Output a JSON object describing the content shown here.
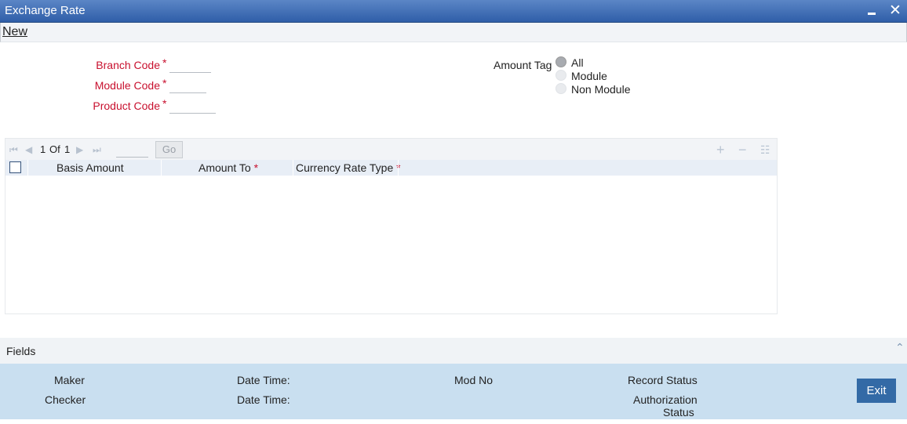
{
  "window": {
    "title": "Exchange Rate"
  },
  "menu": {
    "new_label": "New"
  },
  "form": {
    "branch_code_label": "Branch Code",
    "module_code_label": "Module Code",
    "product_code_label": "Product Code",
    "required_mark": "*",
    "branch_code_value": "",
    "module_code_value": "",
    "product_code_value": "",
    "amount_tag_label": "Amount Tag",
    "amount_tag_options": [
      "All",
      "Module",
      "Non Module"
    ],
    "amount_tag_selected": "All"
  },
  "grid": {
    "current_page": "1",
    "of_label": "Of",
    "total_pages": "1",
    "page_input_value": "",
    "go_label": "Go",
    "columns": [
      "Basis Amount",
      "Amount To",
      "Currency Rate Type"
    ],
    "required_columns": [
      "Amount To",
      "Currency Rate Type"
    ],
    "rows": []
  },
  "fields_section": {
    "label": "Fields"
  },
  "footer": {
    "maker_label": "Maker",
    "checker_label": "Checker",
    "date_time_label_1": "Date Time:",
    "date_time_label_2": "Date Time:",
    "mod_no_label": "Mod No",
    "record_status_label": "Record Status",
    "authorization_label": "Authorization",
    "status_label": "Status",
    "exit_label": "Exit"
  },
  "colors": {
    "title_bar": "#2f5ea8",
    "required_text": "#c8102e",
    "footer_bg": "#c9dff0",
    "exit_button": "#336aa6"
  },
  "icons": [
    "minimize-icon",
    "close-icon",
    "first-page-icon",
    "prev-page-icon",
    "next-page-icon",
    "last-page-icon",
    "add-row-icon",
    "delete-row-icon",
    "single-view-icon",
    "collapse-caret-icon"
  ]
}
